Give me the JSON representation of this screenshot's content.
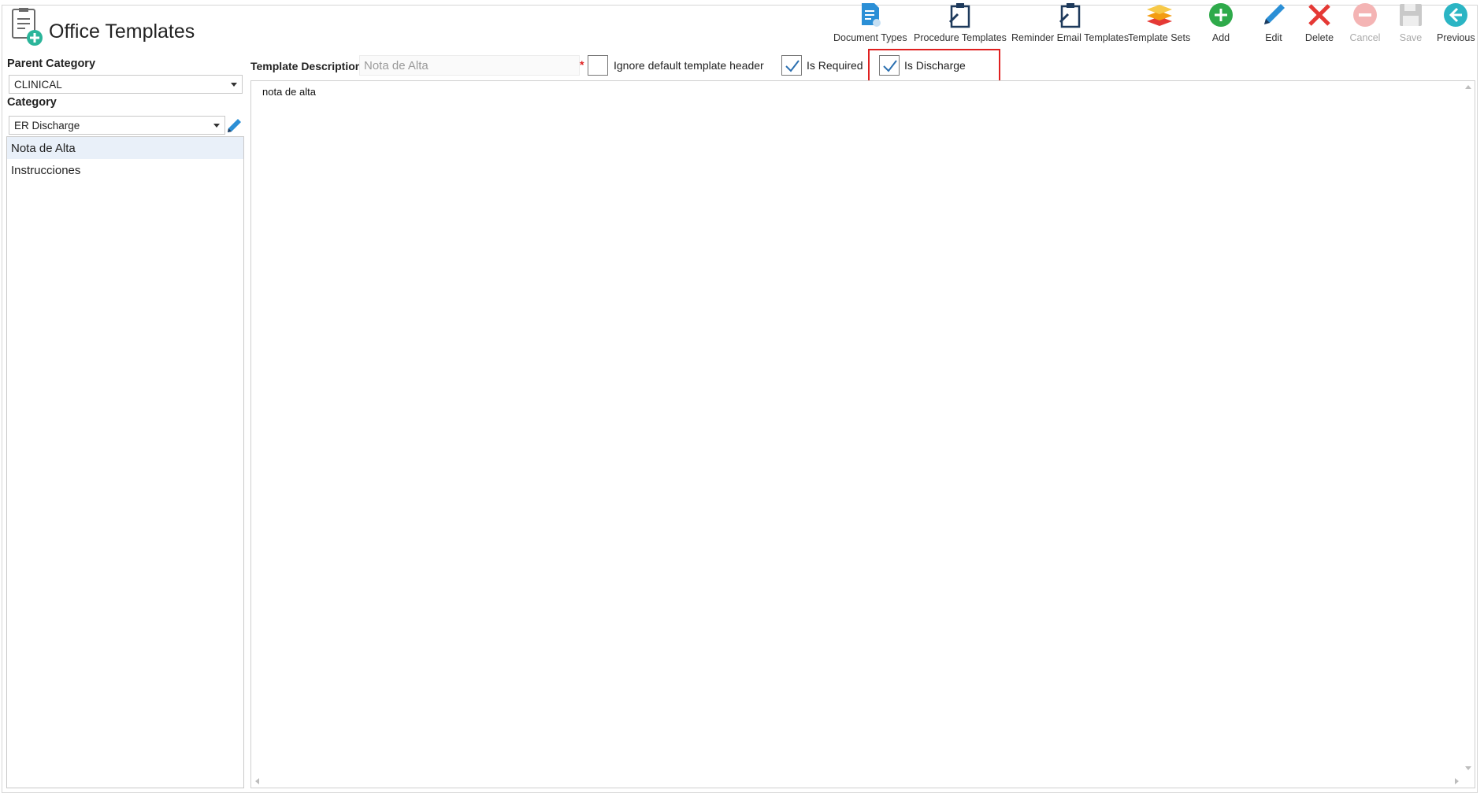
{
  "app": {
    "title": "Office Templates"
  },
  "toolbar": {
    "document_types": "Document Types",
    "procedure_templates": "Procedure Templates",
    "reminder_email_templates": "Reminder Email Templates",
    "template_sets": "Template Sets",
    "add": "Add",
    "edit": "Edit",
    "delete": "Delete",
    "cancel": "Cancel",
    "save": "Save",
    "previous": "Previous"
  },
  "left": {
    "parent_category_label": "Parent Category",
    "parent_category_value": "CLINICAL",
    "category_label": "Category",
    "category_value": "ER Discharge",
    "templates": [
      {
        "label": "Nota de Alta",
        "selected": true
      },
      {
        "label": "Instrucciones",
        "selected": false
      }
    ]
  },
  "form": {
    "template_description_label": "Template Description",
    "template_description_value": "Nota de Alta",
    "required_marker": "*",
    "ignore_header_label": "Ignore default template header",
    "ignore_header_checked": false,
    "is_required_label": "Is Required",
    "is_required_checked": true,
    "is_discharge_label": "Is Discharge",
    "is_discharge_checked": true
  },
  "editor": {
    "content": "nota de alta"
  },
  "colors": {
    "accent_blue": "#2b8fd6",
    "add_green": "#2eaa4a",
    "delete_red": "#e53935",
    "highlight_red": "#e02020"
  }
}
